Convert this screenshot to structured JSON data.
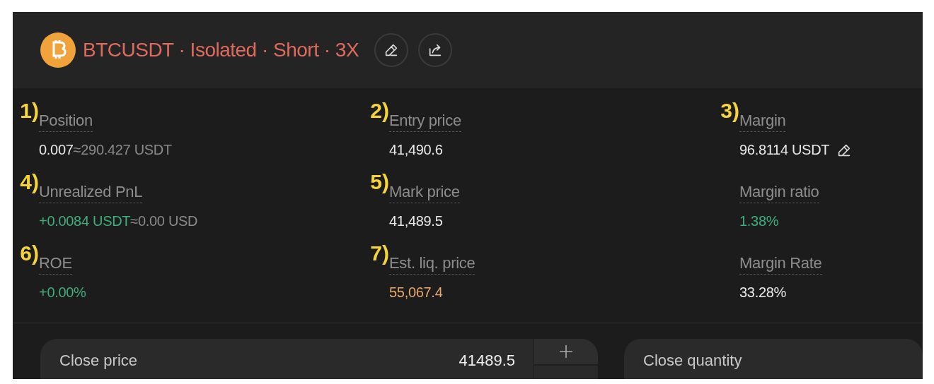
{
  "header": {
    "title": "BTCUSDT · Isolated · Short · 3X"
  },
  "stats": [
    {
      "marker": "1)",
      "label": "Position",
      "value": [
        {
          "text": "0.007",
          "color": "#e9e9e9"
        },
        {
          "text": "≈290.427 USDT",
          "color": "#8a8a8a"
        }
      ]
    },
    {
      "marker": "2)",
      "label": "Entry price",
      "value": [
        {
          "text": "41,490.6",
          "color": "#e9e9e9"
        }
      ]
    },
    {
      "marker": "3)",
      "label": "Margin",
      "value": [
        {
          "text": "96.8114 USDT",
          "color": "#e9e9e9"
        }
      ],
      "editable": true
    },
    {
      "marker": "4)",
      "label": "Unrealized PnL",
      "value": [
        {
          "text": "+0.0084 USDT",
          "color": "#3fae7c"
        },
        {
          "text": "≈0.00 USD",
          "color": "#8a8a8a"
        }
      ]
    },
    {
      "marker": "5)",
      "label": "Mark price",
      "value": [
        {
          "text": "41,489.5",
          "color": "#e9e9e9"
        }
      ]
    },
    {
      "label": "Margin ratio",
      "value": [
        {
          "text": "1.38%",
          "color": "#3fae7c"
        }
      ]
    },
    {
      "marker": "6)",
      "label": "ROE",
      "value": [
        {
          "text": "+0.00%",
          "color": "#3fae7c"
        }
      ]
    },
    {
      "marker": "7)",
      "label": "Est. liq. price",
      "value": [
        {
          "text": "55,067.4",
          "color": "#e8a66a"
        }
      ]
    },
    {
      "label": "Margin Rate",
      "value": [
        {
          "text": "33.28%",
          "color": "#e9e9e9"
        }
      ]
    }
  ],
  "fields": [
    {
      "label": "Close price",
      "value": "41489.5",
      "stepper": true
    },
    {
      "label": "Close quantity"
    }
  ]
}
